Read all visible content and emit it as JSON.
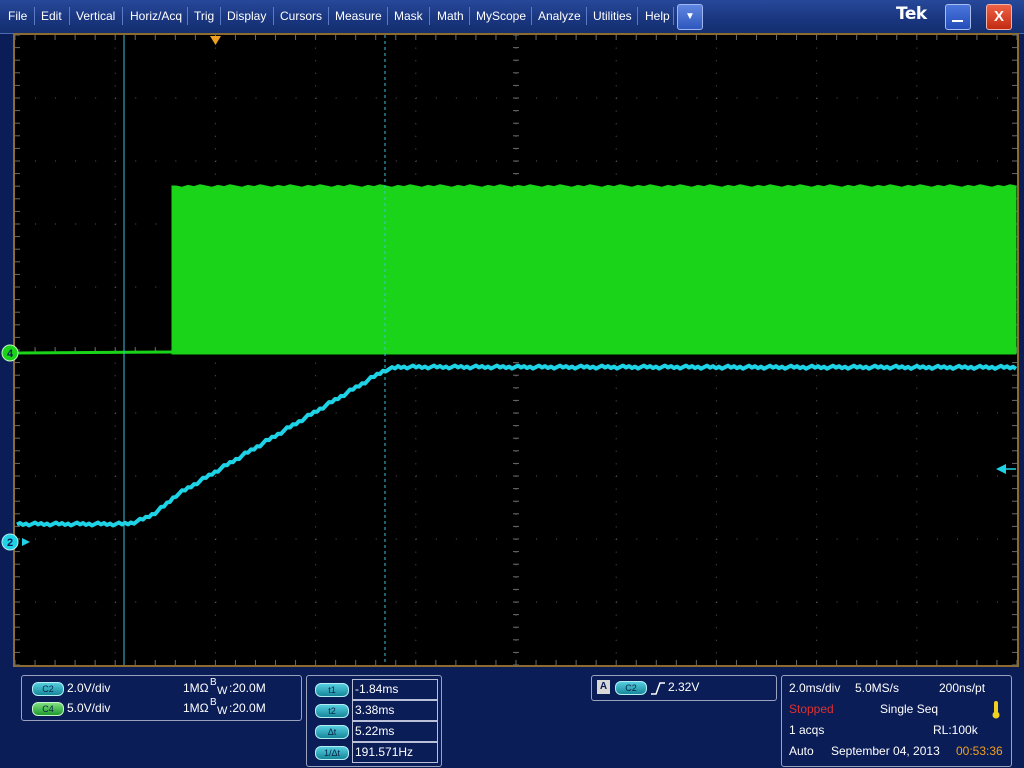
{
  "menu": {
    "items": [
      "File",
      "Edit",
      "Vertical",
      "Horiz/Acq",
      "Trig",
      "Display",
      "Cursors",
      "Measure",
      "Mask",
      "Math",
      "MyScope",
      "Analyze",
      "Utilities",
      "Help"
    ],
    "dropdown_icon": "chevron-down-icon",
    "logo": "Tek",
    "minimize_icon": "minimize-icon",
    "close_icon": "close-icon",
    "close_label": "X"
  },
  "waveform": {
    "channel4_marker": "4",
    "channel2_marker": "2",
    "trace_colors": {
      "ch4": "#19d419",
      "ch2": "#1fd3e6"
    }
  },
  "channels": {
    "c2": {
      "tag": "C2",
      "scale": "2.0V/div",
      "coupling": "1MΩ",
      "bw_prefix": "B",
      "bw_sub": "W",
      "bw": ":20.0M"
    },
    "c4": {
      "tag": "C4",
      "scale": "5.0V/div",
      "coupling": "1MΩ",
      "bw_prefix": "B",
      "bw_sub": "W",
      "bw": ":20.0M"
    }
  },
  "cursors": {
    "rows": [
      {
        "tag": "t1",
        "value": "-1.84ms"
      },
      {
        "tag": "t2",
        "value": "3.38ms"
      },
      {
        "tag": "Δt",
        "value": "5.22ms"
      },
      {
        "tag": "1/Δt",
        "value": "191.571Hz"
      }
    ]
  },
  "trigger": {
    "label": "A",
    "source": "C2",
    "slope_icon": "rising-edge-icon",
    "level": "2.32V"
  },
  "acquisition": {
    "timebase": "2.0ms/div",
    "sample_rate": "5.0MS/s",
    "resolution": "200ns/pt",
    "status": "Stopped",
    "mode": "Single Seq",
    "acqs": "1 acqs",
    "record_length": "RL:100k",
    "trigger_mode": "Auto",
    "date": "September 04, 2013",
    "time": "00:53:36",
    "status_color": "#e03030",
    "time_color": "#f0a020"
  }
}
